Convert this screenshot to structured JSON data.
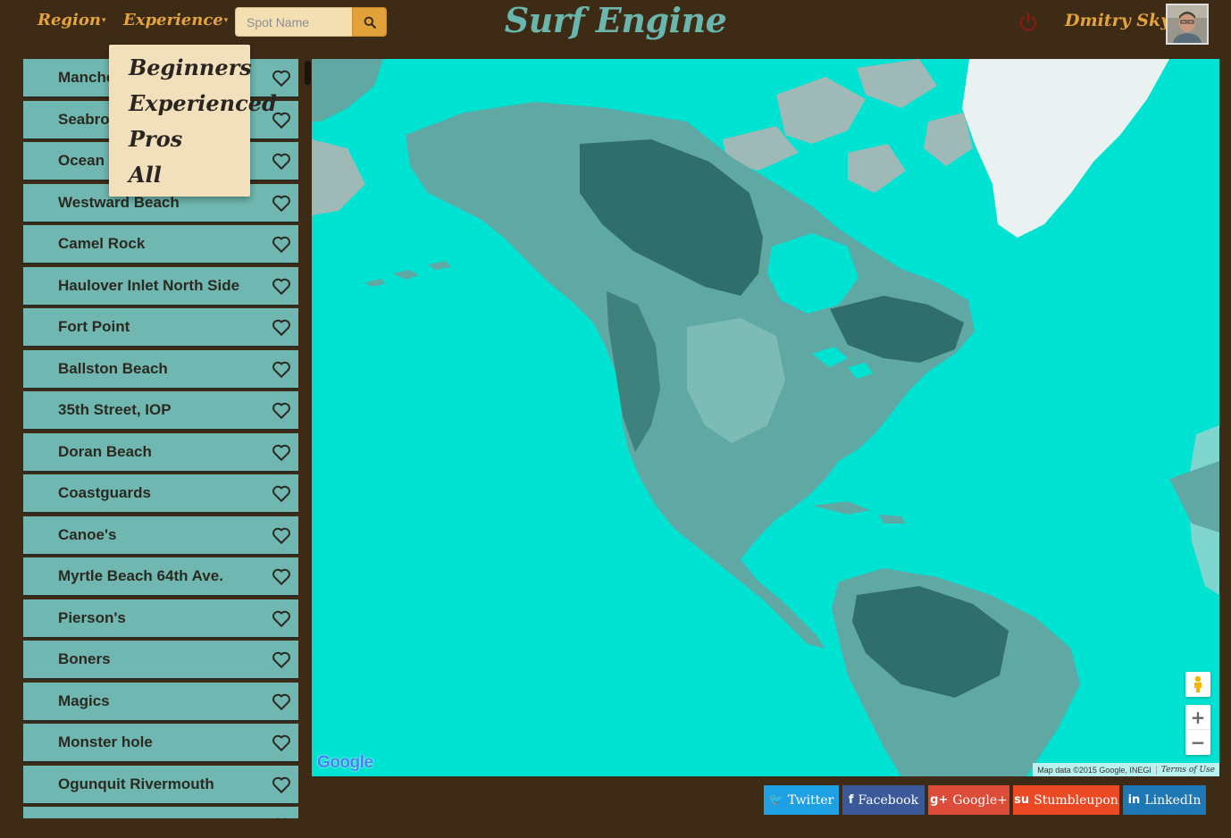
{
  "header": {
    "nav": [
      {
        "label": "Region"
      },
      {
        "label": "Experience"
      }
    ],
    "search": {
      "placeholder": "Spot Name",
      "value": ""
    },
    "brand": "Surf Engine",
    "user": {
      "name": "Dmitry Sky"
    }
  },
  "experience_menu": {
    "items": [
      "Beginners",
      "Experienced",
      "Pros",
      "All"
    ]
  },
  "spots": [
    "Manchester",
    "Seabrook",
    "Ocean Park",
    "Westward Beach",
    "Camel Rock",
    "Haulover Inlet North Side",
    "Fort Point",
    "Ballston Beach",
    "35th Street, IOP",
    "Doran Beach",
    "Coastguards",
    "Canoe's",
    "Myrtle Beach 64th Ave.",
    "Pierson's",
    "Boners",
    "Magics",
    "Monster hole",
    "Ogunquit Rivermouth",
    ""
  ],
  "map": {
    "logo": "Google",
    "attribution": "Map data ©2015 Google, INEGI",
    "terms": "Terms of Use",
    "zoom_in": "+",
    "zoom_out": "−"
  },
  "share": [
    {
      "label": "Twitter",
      "icon": "twitter-icon",
      "glyph": "🐦",
      "color": "#1da1e2"
    },
    {
      "label": "Facebook",
      "icon": "facebook-icon",
      "glyph": "f",
      "color": "#3b5998"
    },
    {
      "label": "Google+",
      "icon": "google-plus-icon",
      "glyph": "g+",
      "color": "#dd4b39"
    },
    {
      "label": "Stumbleupon",
      "icon": "stumbleupon-icon",
      "glyph": "su",
      "color": "#eb4924"
    },
    {
      "label": "LinkedIn",
      "icon": "linkedin-icon",
      "glyph": "in",
      "color": "#1f77b4"
    }
  ],
  "colors": {
    "background": "#3d2b16",
    "accent": "#e3a43d",
    "brand": "#6ab6ad",
    "list_item": "#6fb7b0",
    "ocean": "#00e2d2",
    "power_icon": "#8b1a12"
  }
}
